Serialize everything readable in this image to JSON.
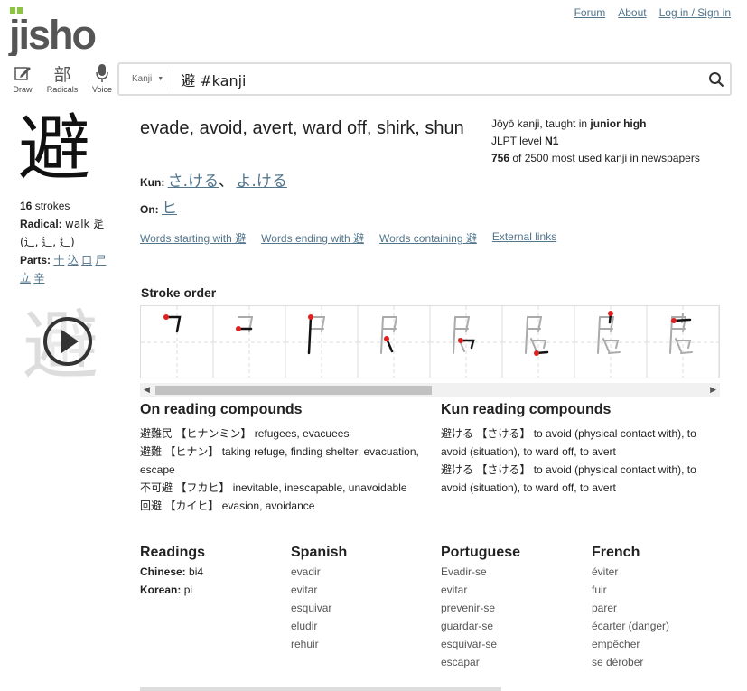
{
  "header": {
    "logo": "jisho",
    "nav": [
      "Forum",
      "About",
      "Log in / Sign in"
    ]
  },
  "tools": [
    {
      "label": "Draw",
      "icon": "pencil-icon"
    },
    {
      "label": "Radicals",
      "icon": "radical-icon",
      "glyph": "部"
    },
    {
      "label": "Voice",
      "icon": "microphone-icon"
    }
  ],
  "search": {
    "type_label": "Kanji",
    "value": "避 #kanji"
  },
  "kanji": {
    "character": "避",
    "strokes_count": "16",
    "strokes_word": "strokes",
    "radical_label": "Radical:",
    "radical_value": "walk 辵",
    "radical_variants": "(⻌, ⻍, ⻎)",
    "parts_label": "Parts:",
    "parts": [
      "十",
      "込",
      "口",
      "尸",
      "立",
      "辛"
    ],
    "meanings": "evade, avoid, avert, ward off, shirk, shun",
    "kun_label": "Kun:",
    "kun_readings": [
      "さ.ける",
      "よ.ける"
    ],
    "kun_sep": "、",
    "on_label": "On:",
    "on_readings": [
      "ヒ"
    ],
    "joyo_prefix": "Jōyō kanji, taught in ",
    "joyo_grade": "junior high",
    "jlpt_prefix": "JLPT level ",
    "jlpt_level": "N1",
    "freq_rank": "756",
    "freq_suffix": " of 2500 most used kanji in newspapers"
  },
  "links": [
    "Words starting with 避",
    "Words ending with 避",
    "Words containing 避",
    "External links"
  ],
  "stroke_order": {
    "title": "Stroke order",
    "frames": 8
  },
  "on_compounds": {
    "title": "On reading compounds",
    "items": [
      {
        "word": "避難民",
        "reading": "【ヒナンミン】",
        "meaning": "refugees, evacuees"
      },
      {
        "word": "避難",
        "reading": "【ヒナン】",
        "meaning": "taking refuge, finding shelter, evacuation, escape"
      },
      {
        "word": "不可避",
        "reading": "【フカヒ】",
        "meaning": "inevitable, inescapable, unavoidable"
      },
      {
        "word": "回避",
        "reading": "【カイヒ】",
        "meaning": "evasion, avoidance"
      }
    ]
  },
  "kun_compounds": {
    "title": "Kun reading compounds",
    "items": [
      {
        "word": "避ける",
        "reading": "【さける】",
        "meaning": "to avoid (physical contact with), to avoid (situation), to ward off, to avert"
      },
      {
        "word": "避ける",
        "reading": "【さける】",
        "meaning": "to avoid (physical contact with), to avoid (situation), to ward off, to avert"
      }
    ]
  },
  "readings": {
    "title": "Readings",
    "items": [
      {
        "label": "Chinese:",
        "value": "bi4"
      },
      {
        "label": "Korean:",
        "value": "pi"
      }
    ]
  },
  "spanish": {
    "title": "Spanish",
    "items": [
      "evadir",
      "evitar",
      "esquivar",
      "eludir",
      "rehuir"
    ]
  },
  "portuguese": {
    "title": "Portuguese",
    "items": [
      "Evadir-se",
      "evitar",
      "prevenir-se",
      "guardar-se",
      "esquivar-se",
      "escapar"
    ]
  },
  "french": {
    "title": "French",
    "items": [
      "éviter",
      "fuir",
      "parer",
      "écarter (danger)",
      "empêcher",
      "se dérober"
    ]
  },
  "colors": {
    "link": "#51758c",
    "logo_green": "#8cc63f",
    "stroke_dot": "#e02020"
  }
}
